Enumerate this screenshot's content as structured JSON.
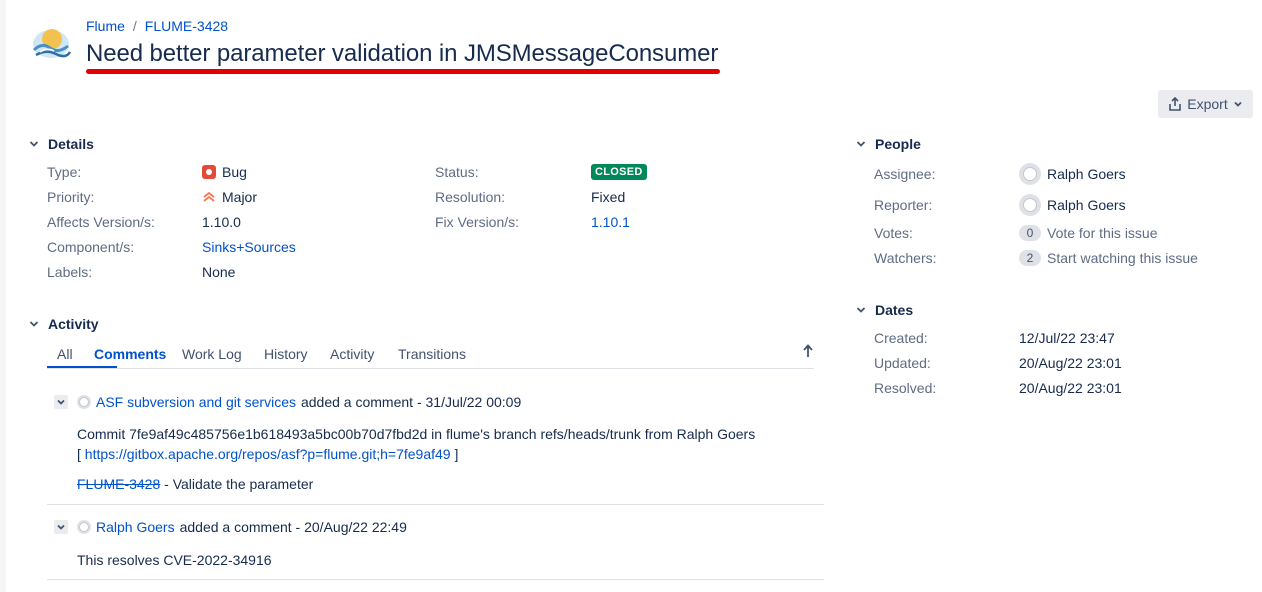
{
  "breadcrumb": {
    "project": "Flume",
    "separator": "/",
    "issue_key": "FLUME-3428"
  },
  "title": "Need better parameter validation in JMSMessageConsumer",
  "export_label": "Export",
  "details": {
    "heading": "Details",
    "left": [
      {
        "label": "Type:",
        "value": "Bug"
      },
      {
        "label": "Priority:",
        "value": "Major"
      },
      {
        "label": "Affects Version/s:",
        "value": "1.10.0"
      },
      {
        "label": "Component/s:",
        "value": "Sinks+Sources"
      },
      {
        "label": "Labels:",
        "value": "None"
      }
    ],
    "right": [
      {
        "label": "Status:",
        "value": "CLOSED"
      },
      {
        "label": "Resolution:",
        "value": "Fixed"
      },
      {
        "label": "Fix Version/s:",
        "value": "1.10.1"
      }
    ]
  },
  "people": {
    "heading": "People",
    "assignee_label": "Assignee:",
    "assignee": "Ralph Goers",
    "reporter_label": "Reporter:",
    "reporter": "Ralph Goers",
    "votes_label": "Votes:",
    "votes_count": "0",
    "votes_action": "Vote for this issue",
    "watchers_label": "Watchers:",
    "watchers_count": "2",
    "watchers_action": "Start watching this issue"
  },
  "dates": {
    "heading": "Dates",
    "created_label": "Created:",
    "created": "12/Jul/22 23:47",
    "updated_label": "Updated:",
    "updated": "20/Aug/22 23:01",
    "resolved_label": "Resolved:",
    "resolved": "20/Aug/22 23:01"
  },
  "activity": {
    "heading": "Activity",
    "tabs": [
      "All",
      "Comments",
      "Work Log",
      "History",
      "Activity",
      "Transitions"
    ],
    "active_tab": "Comments"
  },
  "comments": [
    {
      "author": "ASF subversion and git services",
      "action": "added a comment - 31/Jul/22 00:09",
      "line1": "Commit 7fe9af49c485756e1b618493a5bc00b70d7fbd2d in flume's branch refs/heads/trunk from Ralph Goers",
      "link_open": "[",
      "link": "https://gitbox.apache.org/repos/asf?p=flume.git;h=7fe9af49",
      "link_close": "]",
      "ref_key": "FLUME-3428",
      "ref_text": "- Validate the parameter"
    },
    {
      "author": "Ralph Goers",
      "action": "added a comment - 20/Aug/22 22:49",
      "line1": "This resolves CVE-2022-34916"
    }
  ],
  "colors": {
    "link": "#0052cc",
    "status_closed": "#00875a",
    "bug": "#e5493a",
    "priority_major": "#ff7452",
    "title_underline": "#e50000"
  }
}
